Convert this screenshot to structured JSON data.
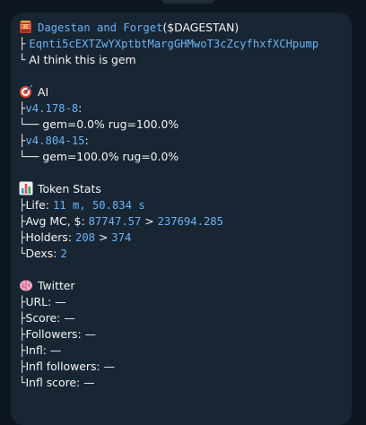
{
  "message": {
    "header": {
      "token_name": "Dagestan and Forget",
      "ticker": "($DAGESTAN)",
      "address": "Eqnti5cEXTZwYXptbtMargGHMwoT3cZcyfhxfXCHpump",
      "comment": "AI think this is gem"
    },
    "ai": {
      "title": "AI",
      "models": [
        {
          "version": "v4.178-8",
          "result": "gem=0.0%  rug=100.0%"
        },
        {
          "version": "v4.804-15",
          "result": "gem=100.0%  rug=0.0%"
        }
      ]
    },
    "token_stats": {
      "title": "Token Stats",
      "life_label": "Life:",
      "life_value": "11 m, 50.834 s",
      "mc_label": "Avg MC, $:",
      "mc_from": "87747.57",
      "mc_arrow": ">",
      "mc_to": "237694.285",
      "holders_label": "Holders:",
      "holders_from": "208",
      "holders_arrow": ">",
      "holders_to": "374",
      "dexs_label": "Dexs:",
      "dexs_value": "2"
    },
    "twitter": {
      "title": "Twitter",
      "rows": [
        {
          "label": "URL:",
          "value": "—"
        },
        {
          "label": "Score:",
          "value": "—"
        },
        {
          "label": "Followers:",
          "value": "—"
        },
        {
          "label": "Infl:",
          "value": "—"
        },
        {
          "label": "Infl followers:",
          "value": "—"
        },
        {
          "label": "Infl score:",
          "value": "—"
        }
      ]
    },
    "icons": {
      "header": "slot-machine-icon",
      "ai": "target-icon",
      "stats": "bar-chart-icon",
      "twitter": "brain-icon"
    }
  }
}
